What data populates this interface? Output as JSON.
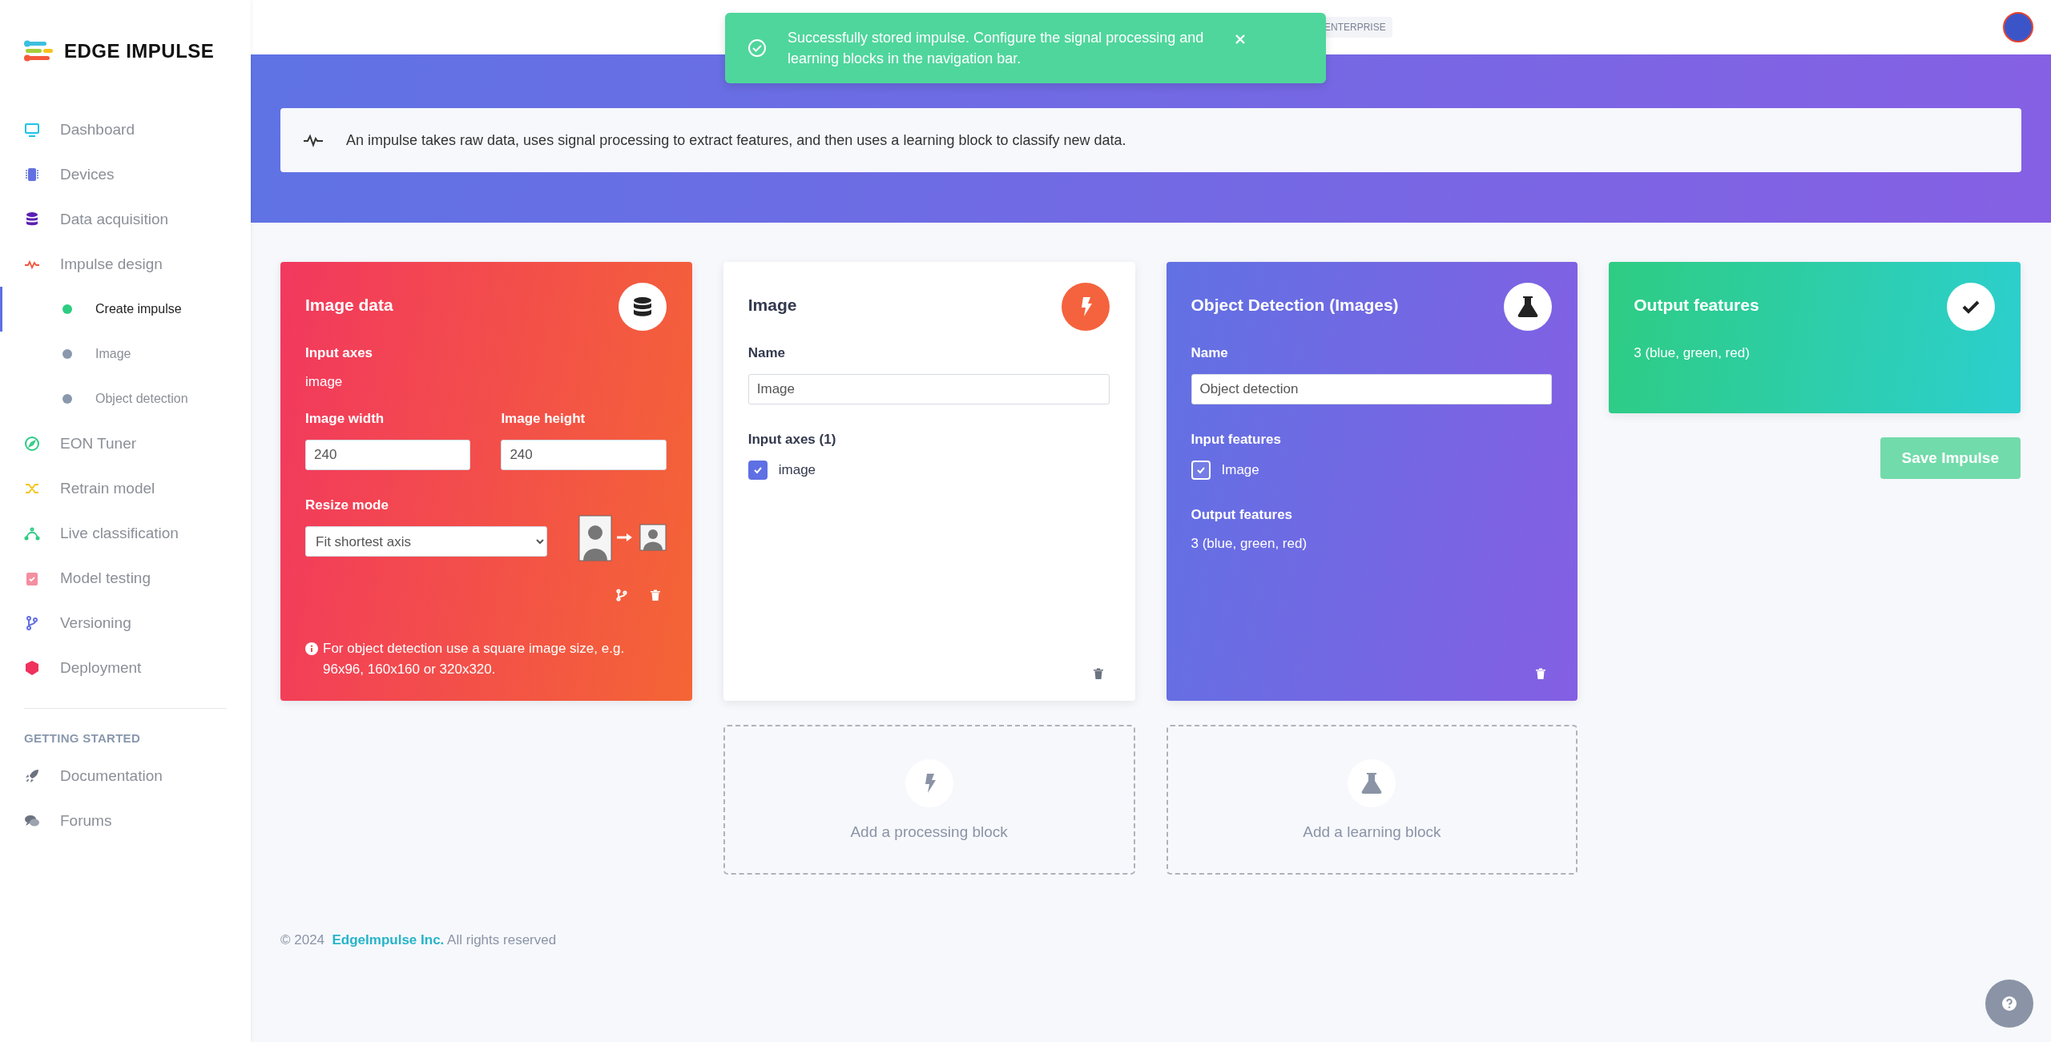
{
  "brand": {
    "name": "EDGE IMPULSE"
  },
  "sidebar": {
    "items": [
      {
        "label": "Dashboard",
        "selected": false
      },
      {
        "label": "Devices",
        "selected": false
      },
      {
        "label": "Data acquisition",
        "selected": false
      },
      {
        "label": "Impulse design",
        "selected": false,
        "children": [
          {
            "label": "Create impulse",
            "selected": true
          },
          {
            "label": "Image",
            "selected": false
          },
          {
            "label": "Object detection",
            "selected": false
          }
        ]
      },
      {
        "label": "EON Tuner",
        "selected": false
      },
      {
        "label": "Retrain model",
        "selected": false
      },
      {
        "label": "Live classification",
        "selected": false
      },
      {
        "label": "Model testing",
        "selected": false
      },
      {
        "label": "Versioning",
        "selected": false
      },
      {
        "label": "Deployment",
        "selected": false
      }
    ],
    "section_title": "GETTING STARTED",
    "section_items": [
      {
        "label": "Documentation"
      },
      {
        "label": "Forums"
      }
    ]
  },
  "topbar": {
    "badge": "ENTERPRISE"
  },
  "toast": {
    "message": "Successfully stored impulse. Configure the signal processing and learning blocks in the navigation bar."
  },
  "info": {
    "text": "An impulse takes raw data, uses signal processing to extract features, and then uses a learning block to classify new data."
  },
  "input_block": {
    "title": "Image data",
    "axes_label": "Input axes",
    "axes_value": "image",
    "width_label": "Image width",
    "width_value": "240",
    "height_label": "Image height",
    "height_value": "240",
    "resize_label": "Resize mode",
    "resize_value": "Fit shortest axis",
    "note": "For object detection use a square image size, e.g. 96x96, 160x160 or 320x320."
  },
  "processing_block": {
    "title": "Image",
    "name_label": "Name",
    "name_value": "Image",
    "axes_label": "Input axes (1)",
    "axes": [
      {
        "label": "image",
        "checked": true
      }
    ]
  },
  "learning_block": {
    "title": "Object Detection (Images)",
    "name_label": "Name",
    "name_value": "Object detection",
    "features_label": "Input features",
    "features": [
      {
        "label": "Image",
        "checked": true
      }
    ],
    "output_label": "Output features",
    "output_value": "3 (blue, green, red)"
  },
  "output_block": {
    "title": "Output features",
    "value": "3 (blue, green, red)"
  },
  "add_blocks": [
    {
      "kind": "processing",
      "label": "Add a processing block"
    },
    {
      "kind": "learning",
      "label": "Add a learning block"
    }
  ],
  "save_button": {
    "label": "Save Impulse"
  },
  "footer": {
    "prefix": "© 2024",
    "link": "EdgeImpulse Inc.",
    "suffix": "All rights reserved"
  }
}
